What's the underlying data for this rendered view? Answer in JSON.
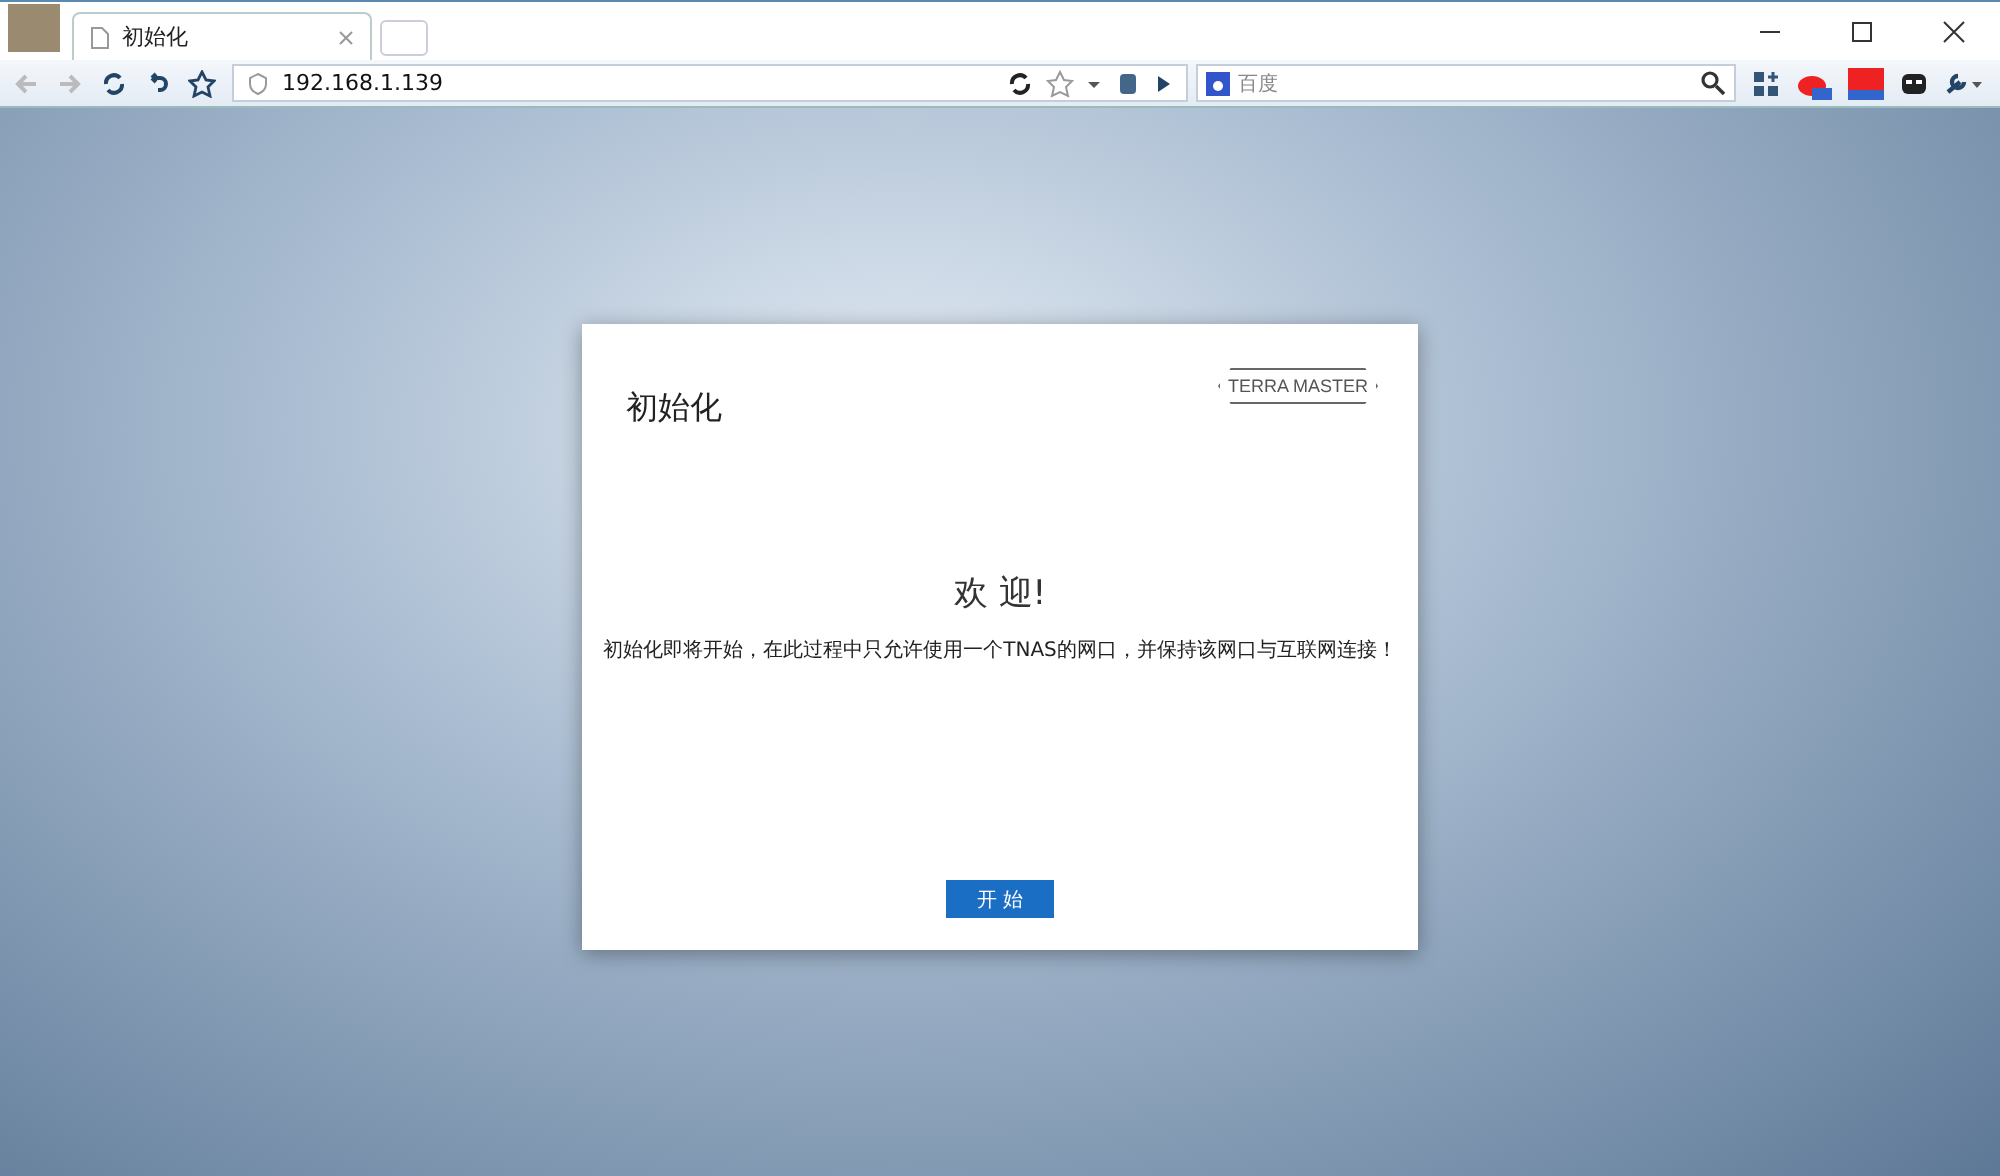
{
  "browser": {
    "tab_title": "初始化",
    "address": "192.168.1.139",
    "search_placeholder": "百度"
  },
  "dialog": {
    "title": "初始化",
    "logo": "TERRA MASTER",
    "heading": "欢 迎!",
    "message": "初始化即将开始，在此过程中只允许使用一个TNAS的网口，并保持该网口与互联网连接！",
    "button": "开 始"
  }
}
